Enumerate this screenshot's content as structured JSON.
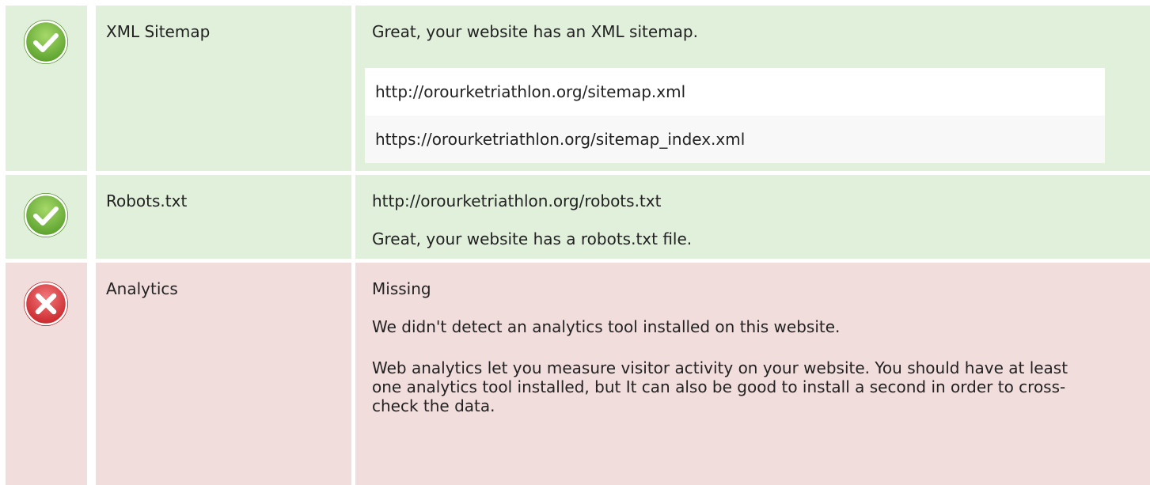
{
  "rows": [
    {
      "status": "pass",
      "icon": "check-icon",
      "label": "XML Sitemap",
      "message": "Great, your website has an XML sitemap.",
      "sitemaps": [
        "http://orourketriathlon.org/sitemap.xml",
        "https://orourketriathlon.org/sitemap_index.xml"
      ]
    },
    {
      "status": "pass",
      "icon": "check-icon",
      "label": "Robots.txt",
      "url": "http://orourketriathlon.org/robots.txt",
      "message": "Great, your website has a robots.txt file."
    },
    {
      "status": "fail",
      "icon": "cross-icon",
      "label": "Analytics",
      "value": "Missing",
      "message": "We didn't detect an analytics tool installed on this website.",
      "description": "Web analytics let you measure visitor activity on your website. You should have at least one analytics tool installed, but It can also be good to install a second in order to cross-check the data."
    }
  ],
  "colors": {
    "pass_background": "#e0f0da",
    "fail_background": "#f2dddd",
    "pass_icon": "#7cc242",
    "fail_icon": "#e03a3e"
  }
}
